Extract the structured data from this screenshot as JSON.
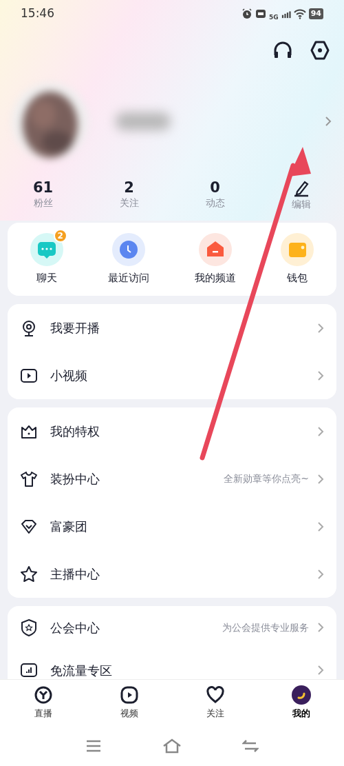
{
  "status_bar": {
    "time": "15:46",
    "battery": "94",
    "network": "5G"
  },
  "header": {
    "actions": [
      {
        "kind": "headset"
      },
      {
        "kind": "settings"
      }
    ]
  },
  "profile": {
    "avatar": {
      "kind": "picture"
    }
  },
  "stats": [
    {
      "value": "61",
      "label": "粉丝",
      "kind": "stat"
    },
    {
      "value": "2",
      "label": "关注",
      "kind": "stat"
    },
    {
      "value": "0",
      "label": "动态",
      "kind": "stat"
    },
    {
      "label": "编辑",
      "kind": "edit"
    }
  ],
  "quick_actions": [
    {
      "label": "聊天",
      "kind": "chat",
      "badge": "2"
    },
    {
      "label": "最近访问",
      "kind": "clock"
    },
    {
      "label": "我的频道",
      "kind": "home"
    },
    {
      "label": "钱包",
      "kind": "wallet"
    }
  ],
  "menu_groups": [
    [
      {
        "label": "我要开播",
        "kind": "camera"
      },
      {
        "label": "小视频",
        "kind": "video"
      }
    ],
    [
      {
        "label": "我的特权",
        "kind": "crown"
      },
      {
        "label": "装扮中心",
        "kind": "shirt",
        "hint": "全新勋章等你点亮~"
      },
      {
        "label": "富豪团",
        "kind": "diamond"
      },
      {
        "label": "主播中心",
        "kind": "star"
      }
    ],
    [
      {
        "label": "公会中心",
        "kind": "shield",
        "hint": "为公会提供专业服务"
      },
      {
        "label": "免流量专区",
        "kind": "chart"
      }
    ]
  ],
  "tab_bar": [
    {
      "label": "直播",
      "kind": "live",
      "selected": false
    },
    {
      "label": "视频",
      "kind": "video",
      "selected": false
    },
    {
      "label": "关注",
      "kind": "heart",
      "selected": false
    },
    {
      "label": "我的",
      "kind": "me",
      "selected": true
    }
  ]
}
